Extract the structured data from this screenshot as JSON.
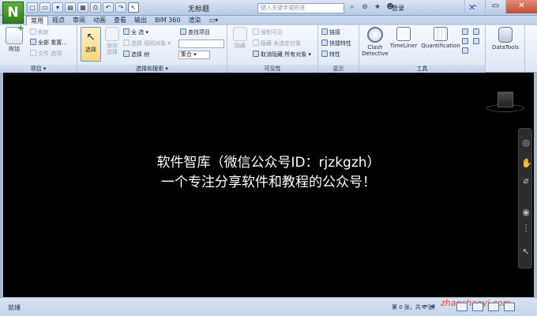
{
  "app": {
    "logo_letter": "N",
    "window_title": "无标题",
    "search_placeholder": "键入关键字或短语",
    "login_label": "登录"
  },
  "quick_access": [
    "□",
    "▭",
    "▾",
    "▤",
    "▦",
    "⎙",
    "↶",
    "↷",
    "↖"
  ],
  "tabs": [
    {
      "label": "常用",
      "active": true
    },
    {
      "label": "视点",
      "active": false
    },
    {
      "label": "审阅",
      "active": false
    },
    {
      "label": "动画",
      "active": false
    },
    {
      "label": "查看",
      "active": false
    },
    {
      "label": "输出",
      "active": false
    },
    {
      "label": "BIM 360",
      "active": false
    },
    {
      "label": "渲染",
      "active": false
    },
    {
      "label": "▭▾",
      "active": false
    }
  ],
  "ribbon": {
    "project": {
      "label": "项目 ▾",
      "append": "附加",
      "refresh": "刷新",
      "reset_all": "全部 重置...",
      "file_options": "文件 选项"
    },
    "select_search": {
      "label": "选择和搜索 ▾",
      "select": "选择",
      "save_selection": "保存选择",
      "select_all": "全 选 ▾",
      "select_same": "选择 相同对象 ▾",
      "selection_tree": "选择 树",
      "find_items": "查找项目",
      "sets": "集合"
    },
    "visibility": {
      "label": "可见性",
      "hide": "隐藏",
      "require": "强制可见",
      "hide_unselected": "隐藏 未选定对象",
      "unhide_all": "取消隐藏 所有对象 ▾"
    },
    "display": {
      "label": "显示",
      "links": "链接",
      "quick_props": "快捷特性",
      "props": "特性"
    },
    "tools": {
      "label": "工具",
      "clash": "Clash Detective",
      "timeliner": "TimeLiner",
      "quantification": "Quantification",
      "datatools": "DataTools"
    }
  },
  "viewport": {
    "line1": "软件智库（微信公众号ID：rjzkgzh）",
    "line2": "一个专注分享软件和教程的公众号！"
  },
  "status": {
    "text": "就绪",
    "page_info": "第 0 张，共 0 张",
    "watermark": "zhanshaoyi.com"
  }
}
